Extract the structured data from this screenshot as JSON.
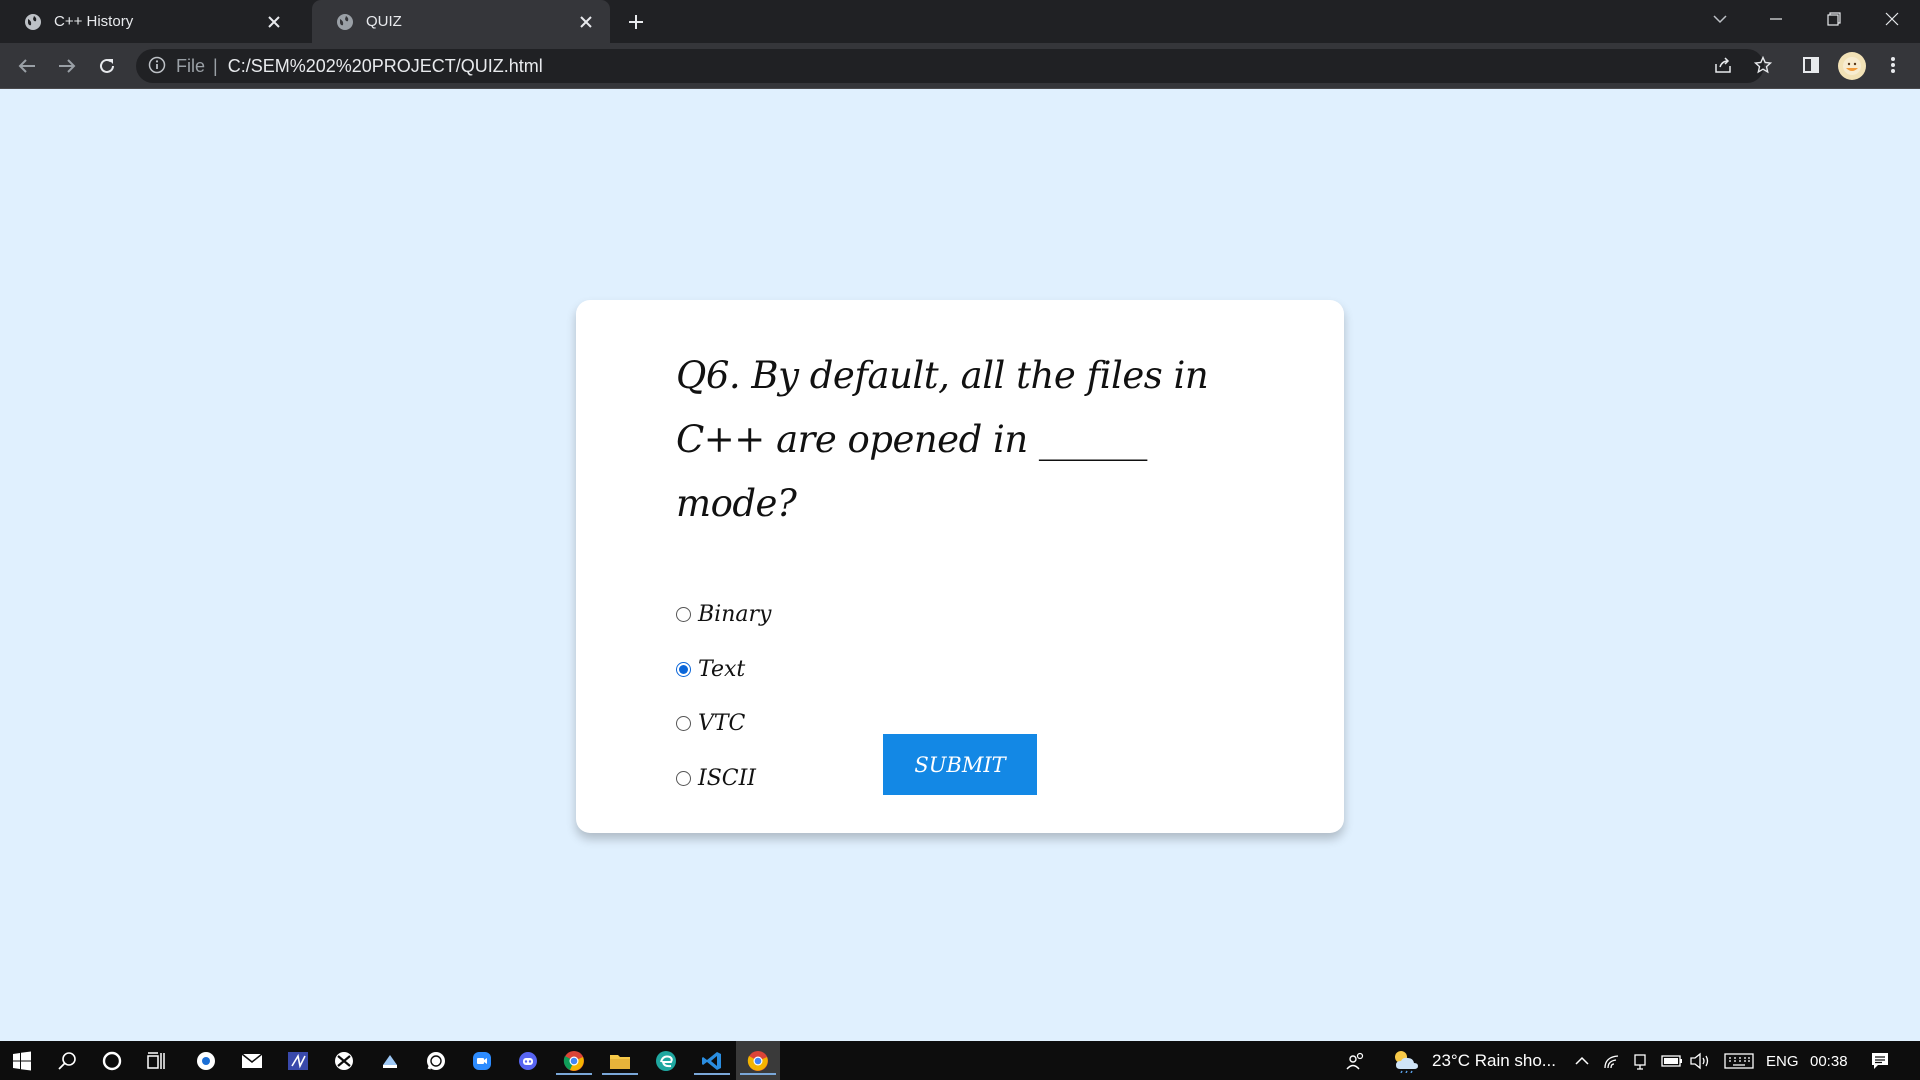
{
  "browser": {
    "tabs": [
      {
        "title": "C++ History",
        "active": false
      },
      {
        "title": "QUIZ",
        "active": true
      }
    ],
    "address": {
      "scheme_label": "File",
      "url": "C:/SEM%202%20PROJECT/QUIZ.html"
    }
  },
  "quiz": {
    "question": "Q6. By default, all the files in C++ are opened in ______ mode?",
    "options": [
      {
        "label": "Binary",
        "selected": false
      },
      {
        "label": "Text",
        "selected": true
      },
      {
        "label": "VTC",
        "selected": false
      },
      {
        "label": "ISCII",
        "selected": false
      }
    ],
    "submit_label": "SUBMIT"
  },
  "colors": {
    "page_background": "#e0f0fe",
    "card_background": "#ffffff",
    "accent": "#1388e5"
  },
  "taskbar": {
    "weather": "23°C  Rain sho...",
    "language": "ENG",
    "time": "00:38"
  }
}
